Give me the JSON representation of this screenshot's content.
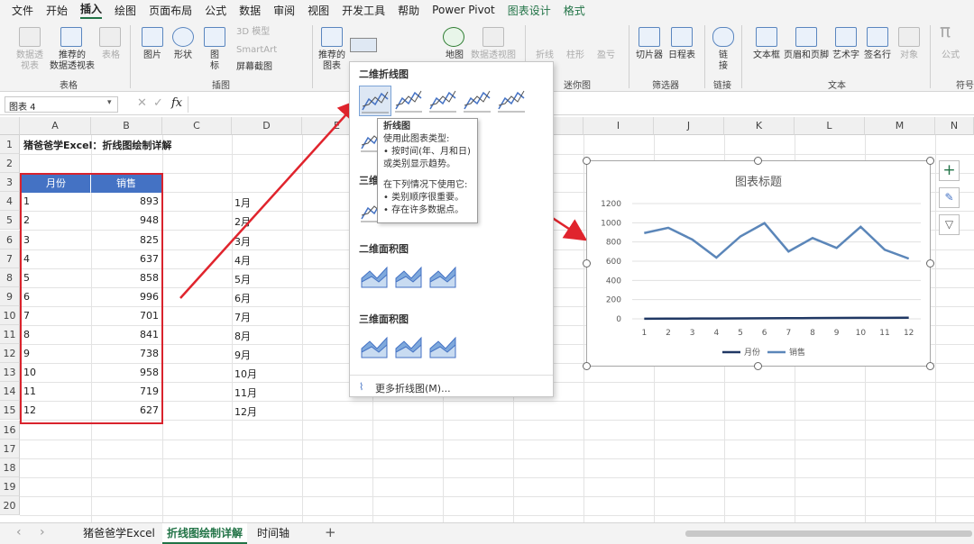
{
  "menu": [
    "文件",
    "开始",
    "插入",
    "绘图",
    "页面布局",
    "公式",
    "数据",
    "审阅",
    "视图",
    "开发工具",
    "帮助",
    "Power Pivot",
    "图表设计",
    "格式"
  ],
  "ribbon": {
    "pivot_label": "数据透\n视表",
    "rec_pivot_label": "推荐的\n数据透视表",
    "table_label": "表格",
    "grp_table": "表格",
    "picture_label": "图片",
    "shape_label": "形状",
    "icon_label": "图\n标",
    "model3d_label": "3D 模型",
    "smartart_label": "SmartArt",
    "screenshot_label": "屏幕截图",
    "grp_illus": "插图",
    "rec_chart_label": "推荐的\n图表",
    "map_label": "地图",
    "pivotchart_label": "数据透视图",
    "spark_line": "折线",
    "spark_col": "柱形",
    "spark_wl": "盈亏",
    "grp_spark": "迷你图",
    "slicer_label": "切片器",
    "timeline_label": "日程表",
    "grp_filter": "筛选器",
    "link_label": "链\n接",
    "grp_link": "链接",
    "textbox_label": "文本框",
    "headerfooter_label": "页眉和页脚",
    "wordart_label": "艺术字",
    "signature_label": "签名行",
    "object_label": "对象",
    "grp_text": "文本",
    "formula_label": "公式",
    "grp_symbol": "符号"
  },
  "namebox": "图表 4",
  "columns": [
    "A",
    "B",
    "C",
    "D",
    "E",
    "F",
    "G",
    "H",
    "I",
    "J",
    "K",
    "L",
    "M",
    "N"
  ],
  "rows": [
    "1",
    "2",
    "3",
    "4",
    "5",
    "6",
    "7",
    "8",
    "9",
    "10",
    "11",
    "12",
    "13",
    "14",
    "15",
    "16",
    "17",
    "18",
    "19",
    "20"
  ],
  "sheet_title": "猪爸爸学Excel：折线图绘制详解",
  "table": {
    "h_month": "月份",
    "h_sales": "销售",
    "months": [
      "1",
      "2",
      "3",
      "4",
      "5",
      "6",
      "7",
      "8",
      "9",
      "10",
      "11",
      "12"
    ],
    "sales": [
      "893",
      "948",
      "825",
      "637",
      "858",
      "996",
      "701",
      "841",
      "738",
      "958",
      "719",
      "627"
    ]
  },
  "month_labels": [
    "1月",
    "2月",
    "3月",
    "4月",
    "5月",
    "6月",
    "7月",
    "8月",
    "9月",
    "10月",
    "11月",
    "12月"
  ],
  "dropdown": {
    "sec_2d_line": "二维折线图",
    "sec_3d_line": "三维",
    "sec_2d_area": "二维面积图",
    "sec_3d_area": "三维面积图",
    "more": "更多折线图(M)..."
  },
  "tooltip": {
    "title": "折线图",
    "l1": "使用此图表类型:",
    "l2": "• 按时间(年、月和日)",
    "l3": "或类别显示趋势。",
    "l4": "在下列情况下使用它:",
    "l5": "• 类别顺序很重要。",
    "l6": "• 存在许多数据点。"
  },
  "chart_data": {
    "type": "line",
    "title": "图表标题",
    "categories": [
      "1",
      "2",
      "3",
      "4",
      "5",
      "6",
      "7",
      "8",
      "9",
      "10",
      "11",
      "12"
    ],
    "series": [
      {
        "name": "月份",
        "values": [
          1,
          2,
          3,
          4,
          5,
          6,
          7,
          8,
          9,
          10,
          11,
          12
        ],
        "color": "#203864"
      },
      {
        "name": "销售",
        "values": [
          893,
          948,
          825,
          637,
          858,
          996,
          701,
          841,
          738,
          958,
          719,
          627
        ],
        "color": "#5b86b9"
      }
    ],
    "yticks": [
      "0",
      "200",
      "400",
      "600",
      "800",
      "1000",
      "1200"
    ],
    "ylim": [
      0,
      1200
    ],
    "grid": true,
    "legend": "bottom"
  },
  "sheet_tabs": [
    "猪爸爸学Excel",
    "折线图绘制详解",
    "时间轴"
  ],
  "nav": {
    "prev": "‹",
    "next": "›",
    "add": "+"
  },
  "colors": {
    "accent": "#217346",
    "table_header": "#4472c4",
    "highlight": "#d9232d"
  }
}
